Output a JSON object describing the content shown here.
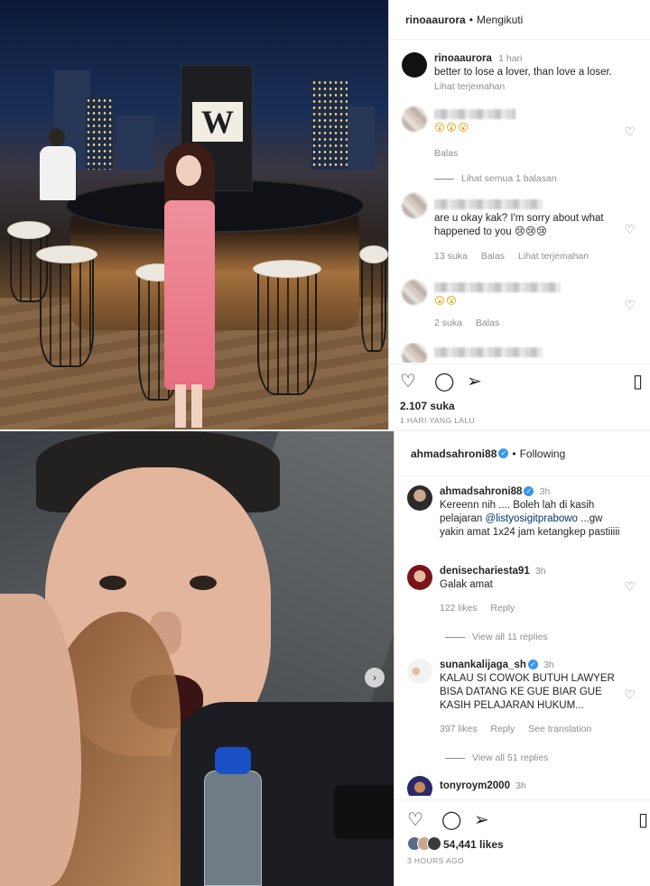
{
  "post1": {
    "header": {
      "username": "rinoaaurora",
      "separator": "•",
      "follow_status": "Mengikuti"
    },
    "caption": {
      "username": "rinoaaurora",
      "time": "1 hari",
      "text": "better to lose a lover, than love a loser.",
      "translate": "Lihat terjemahan"
    },
    "comments": [
      {
        "text": "😮😮😮",
        "meta": [
          "Balas"
        ],
        "view_replies": "Lihat semua 1 balasan"
      },
      {
        "text": "are u okay kak? I'm sorry about what happened to you 😢😢😢",
        "meta": [
          "13 suka",
          "Balas",
          "Lihat terjemahan"
        ]
      },
      {
        "text": "😮😮",
        "meta": [
          "2 suka",
          "Balas"
        ]
      }
    ],
    "likes": "2.107 suka",
    "time_ago": "1 HARI YANG LALU",
    "tower_letter": "W"
  },
  "post2": {
    "header": {
      "username": "ahmadsahroni88",
      "separator": "•",
      "follow_status": "Following"
    },
    "comments": [
      {
        "username": "ahmadsahroni88",
        "time": "3h",
        "text_before": "Kereenn nih .... Boleh lah di kasih pelajaran ",
        "mention": "@listyosigitprabowo",
        "text_after": " ...gw yakin amat 1x24 jam ketangkep pastiiiii"
      },
      {
        "username": "denisechariesta91",
        "time": "3h",
        "text": "Galak amat",
        "meta": [
          "122 likes",
          "Reply"
        ],
        "view_replies": "View all 11 replies"
      },
      {
        "username": "sunankalijaga_sh",
        "time": "3h",
        "text": "KALAU SI COWOK BUTUH LAWYER BISA DATANG KE GUE BIAR GUE KASIH PELAJARAN HUKUM...",
        "meta": [
          "397 likes",
          "Reply",
          "See translation"
        ],
        "view_replies": "View all 51 replies"
      },
      {
        "username": "tonyroym2000",
        "time": "3h"
      }
    ],
    "likes": "54,441 likes",
    "time_ago": "3 HOURS AGO"
  },
  "icons": {
    "heart": "♡",
    "comment": "◯",
    "share": "➢",
    "bookmark": "▯",
    "next": "›",
    "verified": "✓"
  },
  "colors": {
    "verified": "#3897f0",
    "mention": "#00376b",
    "muted": "#8e8e8e"
  }
}
